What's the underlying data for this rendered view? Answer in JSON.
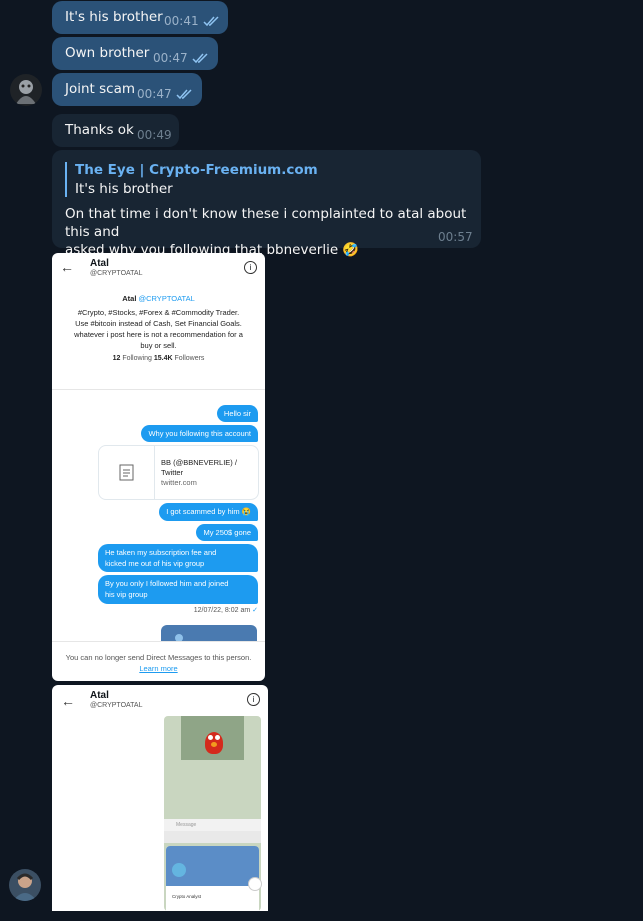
{
  "chat": {
    "messages": [
      {
        "text": "It's his brother",
        "time": "00:41"
      },
      {
        "text": "Own brother",
        "time": "00:47"
      },
      {
        "text": "Joint scam",
        "time": "00:47"
      },
      {
        "text": "Thanks ok",
        "time": "00:49"
      }
    ],
    "reply": {
      "quote_name": "The Eye | Crypto-Freemium.com",
      "quote_text": "It's his brother",
      "line1": "On that time i don't know these i complainted to atal about this and",
      "line2": "asked why you following that bbneverlie",
      "emoji": "🤣",
      "time": "00:57"
    }
  },
  "screenshot1": {
    "header_name": "Atal",
    "header_handle": "@CRYPTOATAL",
    "bio_name": "Atal",
    "bio_handle": "@CRYPTOATAL",
    "bio_line1": "#Crypto, #Stocks, #Forex & #Commodity Trader.",
    "bio_line2": "Use #bitcoin instead of Cash, Set Financial Goals.",
    "bio_line3": "whatever i post here is not a recommendation for a",
    "bio_line4": "buy or sell.",
    "following_count": "12",
    "following_label": "Following",
    "followers_count": "15.4K",
    "followers_label": "Followers",
    "dm1": "Hello sir",
    "dm2": "Why you following this account",
    "card_title1": "BB (@BBNEVERLIE) /",
    "card_title2": "Twitter",
    "card_domain": "twitter.com",
    "dm3": "I got scammed by him 😭",
    "dm4": "My 250$ gone",
    "dm5a": "He taken my subscription fee and",
    "dm5b": "kicked me out of his vip group",
    "dm6a": "By you only I followed him and joined",
    "dm6b": "his vip group",
    "dm_time": "12/07/22, 8:02 am",
    "footer_text": "You can no longer send Direct Messages to this person.",
    "footer_link": "Learn more"
  },
  "screenshot2": {
    "header_name": "Atal",
    "header_handle": "@CRYPTOATAL",
    "inner_input_placeholder": "Message",
    "inner_contact_name": "Crypto Analyst"
  },
  "colors": {
    "background": "#0e1621",
    "outgoing_bubble": "#2b5278",
    "incoming_bubble": "#182533",
    "accent": "#6ab2f2",
    "twitter_blue": "#1d9bf0"
  }
}
